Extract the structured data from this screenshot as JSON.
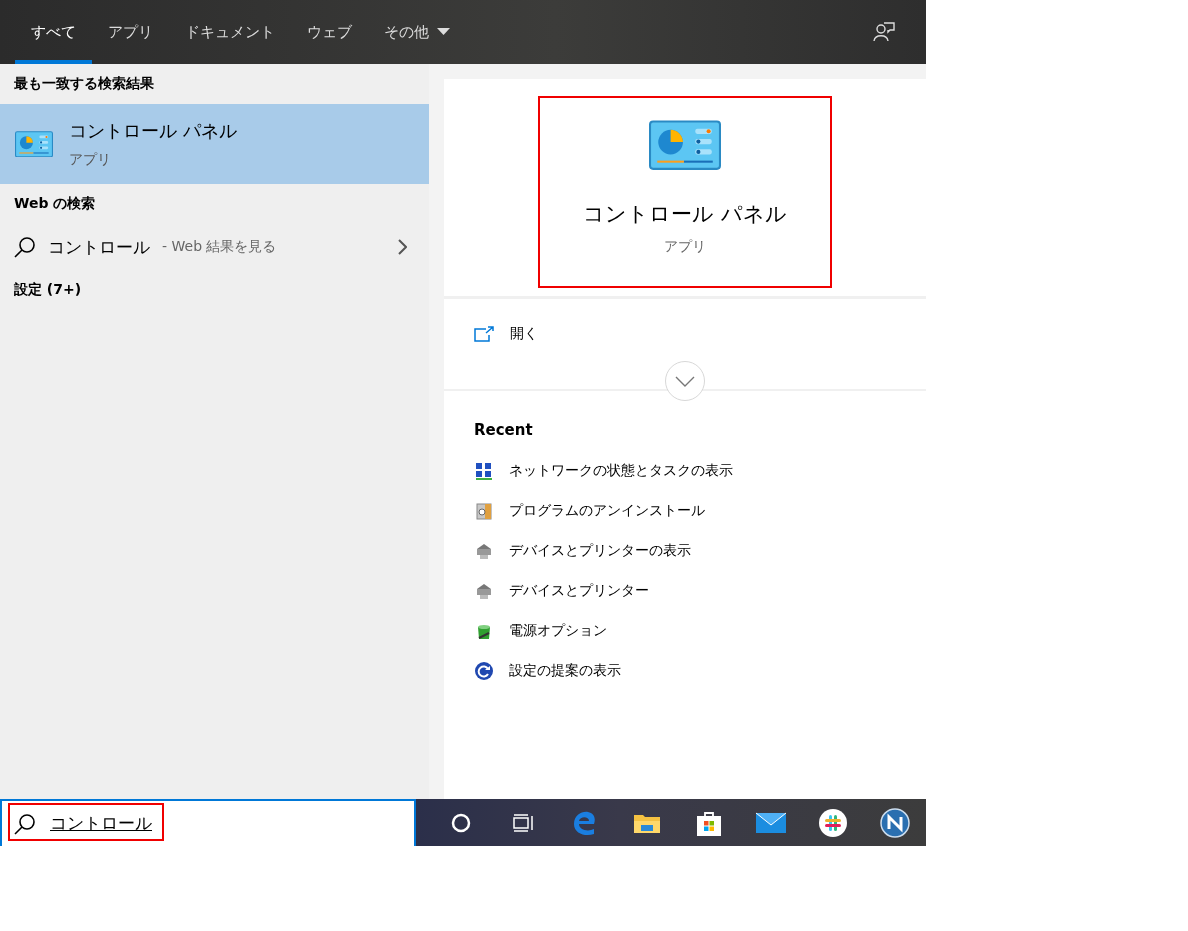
{
  "tabs": [
    {
      "label": "すべて",
      "selected": true,
      "kind": "plain"
    },
    {
      "label": "アプリ",
      "selected": false,
      "kind": "plain"
    },
    {
      "label": "ドキュメント",
      "selected": false,
      "kind": "plain"
    },
    {
      "label": "ウェブ",
      "selected": false,
      "kind": "plain"
    },
    {
      "label": "その他",
      "selected": false,
      "kind": "dropdown"
    }
  ],
  "best_match": {
    "heading": "最も一致する検索結果",
    "title": "コントロール パネル",
    "subtitle": "アプリ",
    "selected": true
  },
  "web_search": {
    "heading": "Web の検索",
    "query": "コントロール",
    "suffix": "- Web 結果を見る"
  },
  "settings": {
    "heading": "設定 (7+)"
  },
  "preview": {
    "title": "コントロール パネル",
    "subtitle": "アプリ",
    "highlighted": true
  },
  "actions": [
    {
      "label": "開く"
    }
  ],
  "recent": {
    "heading": "Recent",
    "items": [
      {
        "label": "ネットワークの状態とタスクの表示",
        "kind": "network"
      },
      {
        "label": "プログラムのアンインストール",
        "kind": "programs"
      },
      {
        "label": "デバイスとプリンターの表示",
        "kind": "devices"
      },
      {
        "label": "デバイスとプリンター",
        "kind": "devices"
      },
      {
        "label": "電源オプション",
        "kind": "power"
      },
      {
        "label": "設定の提案の表示",
        "kind": "suggestions"
      }
    ]
  },
  "search": {
    "value": "コントロール",
    "highlighted": true
  }
}
